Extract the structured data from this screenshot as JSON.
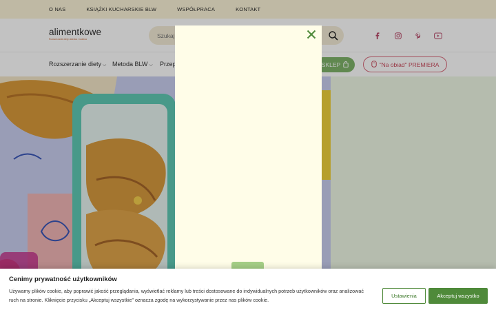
{
  "topbar": {
    "items": [
      "O NAS",
      "KSIĄŻKI KUCHARSKIE BLW",
      "WSPÓŁPRACA",
      "KONTAKT"
    ]
  },
  "header": {
    "logo_text": "alimentkowe",
    "logo_tagline": "Rozszerzanie diety dziecka i rodzina",
    "search_placeholder": "Szukaj",
    "social_icons": [
      "facebook-icon",
      "instagram-icon",
      "pinterest-icon",
      "youtube-icon"
    ]
  },
  "nav": {
    "items": [
      "Rozszerzanie diety",
      "Metoda BLW",
      "Przep"
    ],
    "sklep_label": "SKLEP",
    "premiera_label": "\"Na obiad\" PREMIERA"
  },
  "colors": {
    "accent_green": "#4f8a3a",
    "topbar_bg": "#fbf4d8",
    "modal_bg": "#fffde8",
    "premiera_pink": "#d96b7c"
  },
  "cookie": {
    "title": "Cenimy prywatność użytkowników",
    "text": "Używamy plików cookie, aby poprawić jakość przeglądania, wyświetlać reklamy lub treści dostosowane do indywidualnych potrzeb użytkowników oraz analizować ruch na stronie. Kliknięcie przycisku „Akceptuj wszystkie” oznacza zgodę na wykorzystywanie przez nas plików cookie.",
    "settings_label": "Ustawienia",
    "accept_label": "Akceptuj wszystko"
  }
}
